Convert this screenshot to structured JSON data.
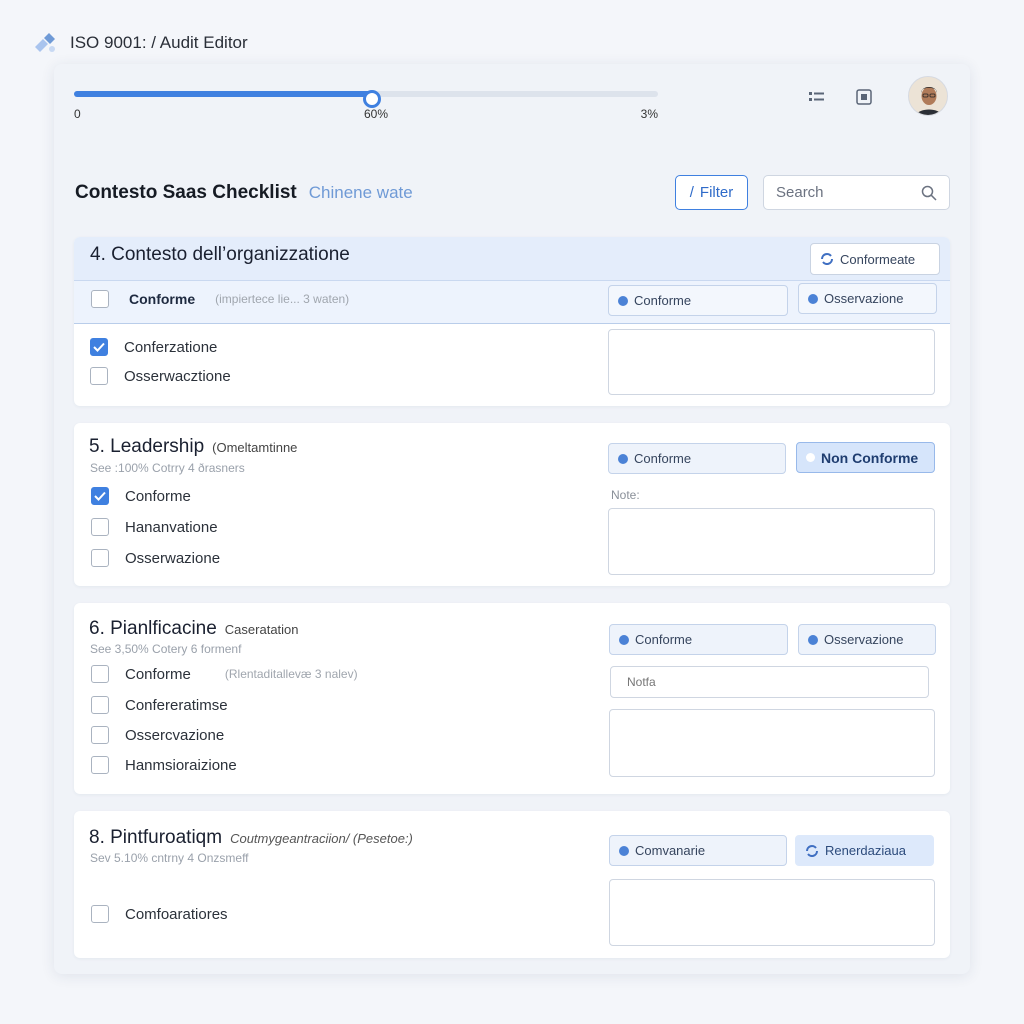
{
  "app": {
    "title": "ISO 9001: / Audit  Editor"
  },
  "progress": {
    "value_percent": 51,
    "start_label": "0",
    "mid_label": "60%",
    "end_label": "3%"
  },
  "header": {
    "title": "Contesto Saas Checklist",
    "subtitle": "Chinene wate",
    "filter_label": "Filter",
    "search_placeholder": "Search"
  },
  "sections": [
    {
      "title": "4. Contesto dell’organizzatione",
      "badge": "Conformeate",
      "header_row": {
        "label": "Conforme",
        "hint": "(impiertece lie... 3 waten)"
      },
      "header_pills": [
        "Conforme",
        "Osservazione"
      ],
      "items": [
        {
          "label": "Conferzatione",
          "checked": true
        },
        {
          "label": "Osserwacztione",
          "checked": false
        }
      ]
    },
    {
      "title": "5. Leadership",
      "tag": "(Omeltamtinne",
      "meta": "See :100% Cotrry 4 ðrasners",
      "pills": [
        "Conforme",
        "Non Conforme"
      ],
      "note_label": "Note:",
      "items": [
        {
          "label": "Conforme",
          "checked": true
        },
        {
          "label": "Hananvatione",
          "checked": false
        },
        {
          "label": "Osserwazione",
          "checked": false
        }
      ]
    },
    {
      "title": "6. Pianlficacine",
      "tag": "Caseratation",
      "meta": "See 3,50% Cotery 6 formenf",
      "pills": [
        "Conforme",
        "Osservazione"
      ],
      "note_placeholder": "Notfa",
      "items": [
        {
          "label": "Conforme",
          "hint": "(Rlentaditallevæ 3 nalev)",
          "checked": false
        },
        {
          "label": "Confereratimse",
          "checked": false
        },
        {
          "label": "Ossercvazione",
          "checked": false
        },
        {
          "label": "Hanmsioraizione",
          "checked": false
        }
      ]
    },
    {
      "title": "8. Pintfuroatiqm",
      "tag": "Coutmygeantraciion/  (Pesetoe:)",
      "meta": "Sev 5.10% cntrny 4 Onzsmeff",
      "pills": [
        "Comvanarie",
        "Renerdaziaua"
      ],
      "items": [
        {
          "label": "Comfoaratiores",
          "checked": false
        }
      ]
    }
  ],
  "colors": {
    "accent": "#3f80e0",
    "page_bg": "#f4f6fa",
    "section_head_bg": "#e4edfb"
  },
  "icons": [
    "app-logo-icon",
    "list-icon",
    "layout-icon",
    "filter-icon",
    "search-icon",
    "sync-icon"
  ]
}
